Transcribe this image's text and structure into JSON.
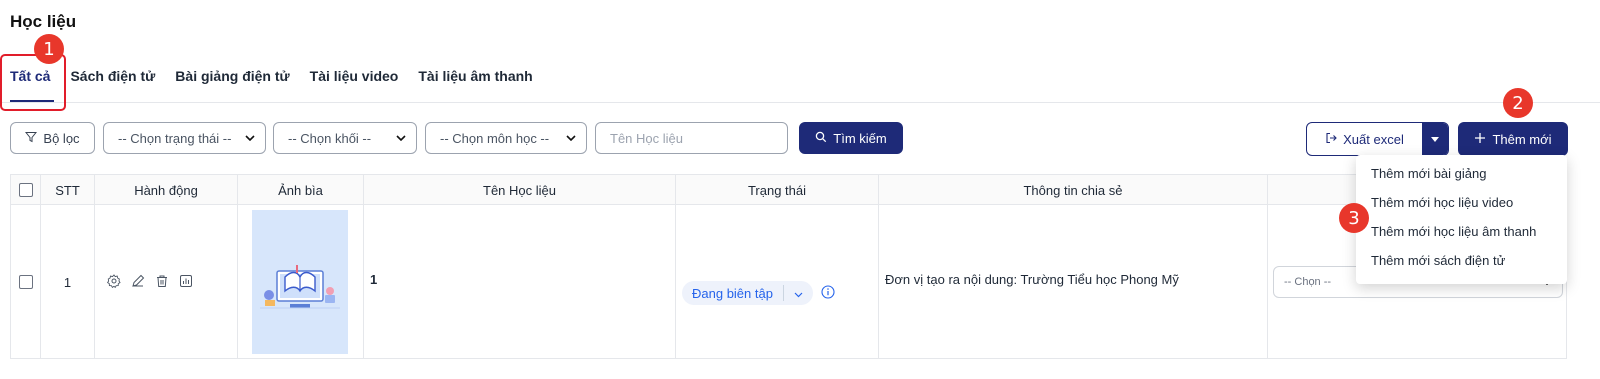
{
  "page": {
    "title": "Học liệu"
  },
  "tabs": [
    {
      "label": "Tất cả",
      "active": true
    },
    {
      "label": "Sách điện tử"
    },
    {
      "label": "Bài giảng điện tử"
    },
    {
      "label": "Tài liệu video"
    },
    {
      "label": "Tài liệu âm thanh"
    }
  ],
  "annotations": {
    "badge1": "1",
    "badge2": "2",
    "badge3": "3"
  },
  "toolbar": {
    "filter_label": "Bộ lọc",
    "status_select": "-- Chọn trạng thái --",
    "grade_select": "-- Chọn khối --",
    "subject_select": "-- Chọn môn học --",
    "search_placeholder": "Tên Học liệu",
    "search_button": "Tìm kiếm",
    "export_button": "Xuất excel",
    "add_button": "Thêm mới"
  },
  "add_menu": [
    "Thêm mới bài giảng",
    "Thêm mới học liệu video",
    "Thêm mới học liệu âm thanh",
    "Thêm mới sách điện tử"
  ],
  "table": {
    "headers": [
      "STT",
      "Hành động",
      "Ảnh bìa",
      "Tên Học liệu",
      "Trạng thái",
      "Thông tin chia sẻ"
    ],
    "rows": [
      {
        "stt": "1",
        "name": "1",
        "status": "Đang biên tập",
        "share_info": "Đơn vị tạo ra nội dung: Trường Tiểu học Phong Mỹ",
        "select_placeholder": "-- Chọn --"
      }
    ]
  },
  "colors": {
    "primary": "#1e2a78",
    "highlight": "#e11d2a",
    "badge": "#e8372b"
  },
  "icons": [
    "filter-icon",
    "search-icon",
    "export-icon",
    "plus-icon",
    "gear-icon",
    "edit-icon",
    "trash-icon",
    "stats-icon",
    "info-icon"
  ]
}
